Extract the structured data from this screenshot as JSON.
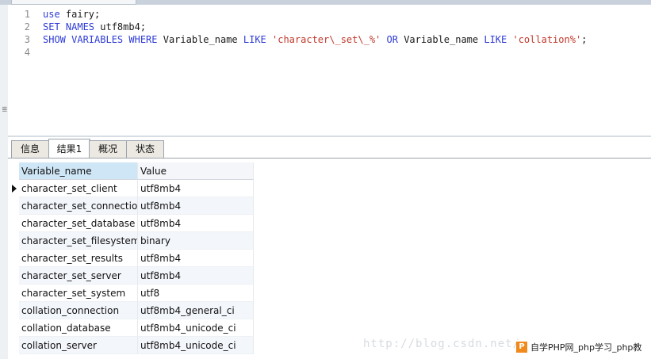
{
  "editor": {
    "lines": [
      {
        "num": "1",
        "parts": [
          {
            "t": "use",
            "c": "kw"
          },
          {
            "t": " fairy;",
            "c": "txt"
          }
        ]
      },
      {
        "num": "2",
        "parts": [
          {
            "t": "SET NAMES",
            "c": "kw"
          },
          {
            "t": " utf8mb4;",
            "c": "txt"
          }
        ]
      },
      {
        "num": "3",
        "parts": [
          {
            "t": "SHOW VARIABLES WHERE",
            "c": "kw"
          },
          {
            "t": " Variable_name ",
            "c": "txt"
          },
          {
            "t": "LIKE",
            "c": "kw"
          },
          {
            "t": " 'character\\_set\\_%'",
            "c": "str"
          },
          {
            "t": " OR",
            "c": "kw"
          },
          {
            "t": " Variable_name ",
            "c": "txt"
          },
          {
            "t": "LIKE",
            "c": "kw"
          },
          {
            "t": " 'collation%'",
            "c": "str"
          },
          {
            "t": ";",
            "c": "txt"
          }
        ]
      },
      {
        "num": "4",
        "parts": []
      }
    ]
  },
  "tabs": [
    {
      "label": "信息",
      "active": false
    },
    {
      "label": "结果1",
      "active": true
    },
    {
      "label": "概况",
      "active": false
    },
    {
      "label": "状态",
      "active": false
    }
  ],
  "grid": {
    "columns": [
      "Variable_name",
      "Value"
    ],
    "rows": [
      [
        "character_set_client",
        "utf8mb4"
      ],
      [
        "character_set_connection",
        "utf8mb4"
      ],
      [
        "character_set_database",
        "utf8mb4"
      ],
      [
        "character_set_filesystem",
        "binary"
      ],
      [
        "character_set_results",
        "utf8mb4"
      ],
      [
        "character_set_server",
        "utf8mb4"
      ],
      [
        "character_set_system",
        "utf8"
      ],
      [
        "collation_connection",
        "utf8mb4_general_ci"
      ],
      [
        "collation_database",
        "utf8mb4_unicode_ci"
      ],
      [
        "collation_server",
        "utf8mb4_unicode_ci"
      ]
    ],
    "current_row": 0
  },
  "watermark": {
    "url": "http://blog.csdn.net/",
    "brand_logo": "P",
    "brand_text": "自学PHP网_php学习_php教"
  },
  "icons": {
    "row_indicator": "row-indicator-arrow-icon",
    "splitter": "splitter-grip-icon",
    "brand_logo": "php-logo-icon"
  }
}
